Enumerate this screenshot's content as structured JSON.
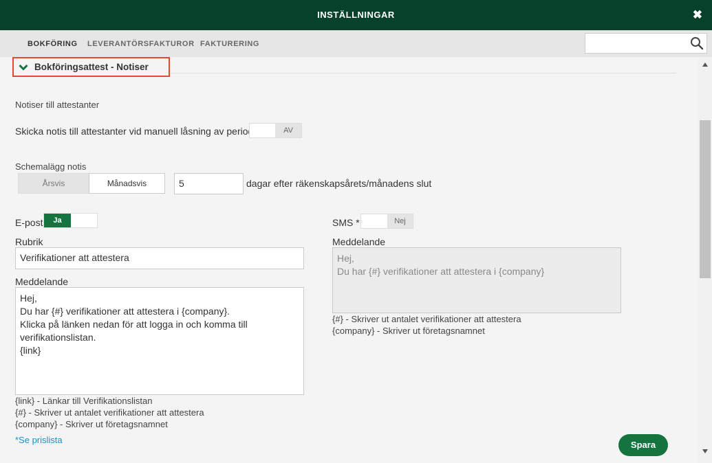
{
  "window": {
    "title": "INSTÄLLNINGAR",
    "close_icon": "close-icon"
  },
  "tabs": [
    {
      "label": "BOKFÖRING",
      "active": true
    },
    {
      "label": "LEVERANTÖRSFAKTUROR",
      "active": false
    },
    {
      "label": "FAKTURERING",
      "active": false
    }
  ],
  "search": {
    "value": "",
    "icon": "search-icon"
  },
  "section": {
    "title": "Bokföringsattest - Notiser",
    "icon": "chevron-down-icon",
    "expanded": true
  },
  "notices": {
    "heading": "Notiser till attestanter",
    "manual_lock": {
      "label": "Skicka notis till attestanter vid manuell låsning av period",
      "toggle_label": "AV",
      "enabled": false
    }
  },
  "schedule": {
    "label": "Schemalägg notis",
    "options": [
      "Årsvis",
      "Månadsvis"
    ],
    "selected": "Månadsvis",
    "days_value": "5",
    "days_suffix": "dagar efter räkenskapsårets/månadens slut"
  },
  "email": {
    "label": "E-post",
    "toggle_label": "Ja",
    "enabled": true,
    "subject_label": "Rubrik",
    "subject_value": "Verifikationer att attestera",
    "message_label": "Meddelande",
    "message_value": "Hej,\nDu har {#} verifikationer att attestera i {company}.\nKlicka på länken nedan för att logga in och komma till verifikationslistan.\n{link}",
    "help": [
      "{link} - Länkar till Verifikationslistan",
      "{#} - Skriver ut antalet verifikationer att attestera",
      "{company} - Skriver ut företagsnamnet"
    ],
    "price_link": "*Se prislista"
  },
  "sms": {
    "label": "SMS *",
    "toggle_label": "Nej",
    "enabled": false,
    "message_label": "Meddelande",
    "message_value": "Hej,\nDu har {#} verifikationer att attestera i {company}",
    "help": [
      "{#} - Skriver ut antalet verifikationer att attestera",
      "{company} - Skriver ut företagsnamnet"
    ]
  },
  "actions": {
    "save_label": "Spara"
  },
  "colors": {
    "header_bg": "#06412a",
    "accent_green": "#14733f",
    "highlight_border": "#e04b2e",
    "link": "#1a8fc7"
  }
}
